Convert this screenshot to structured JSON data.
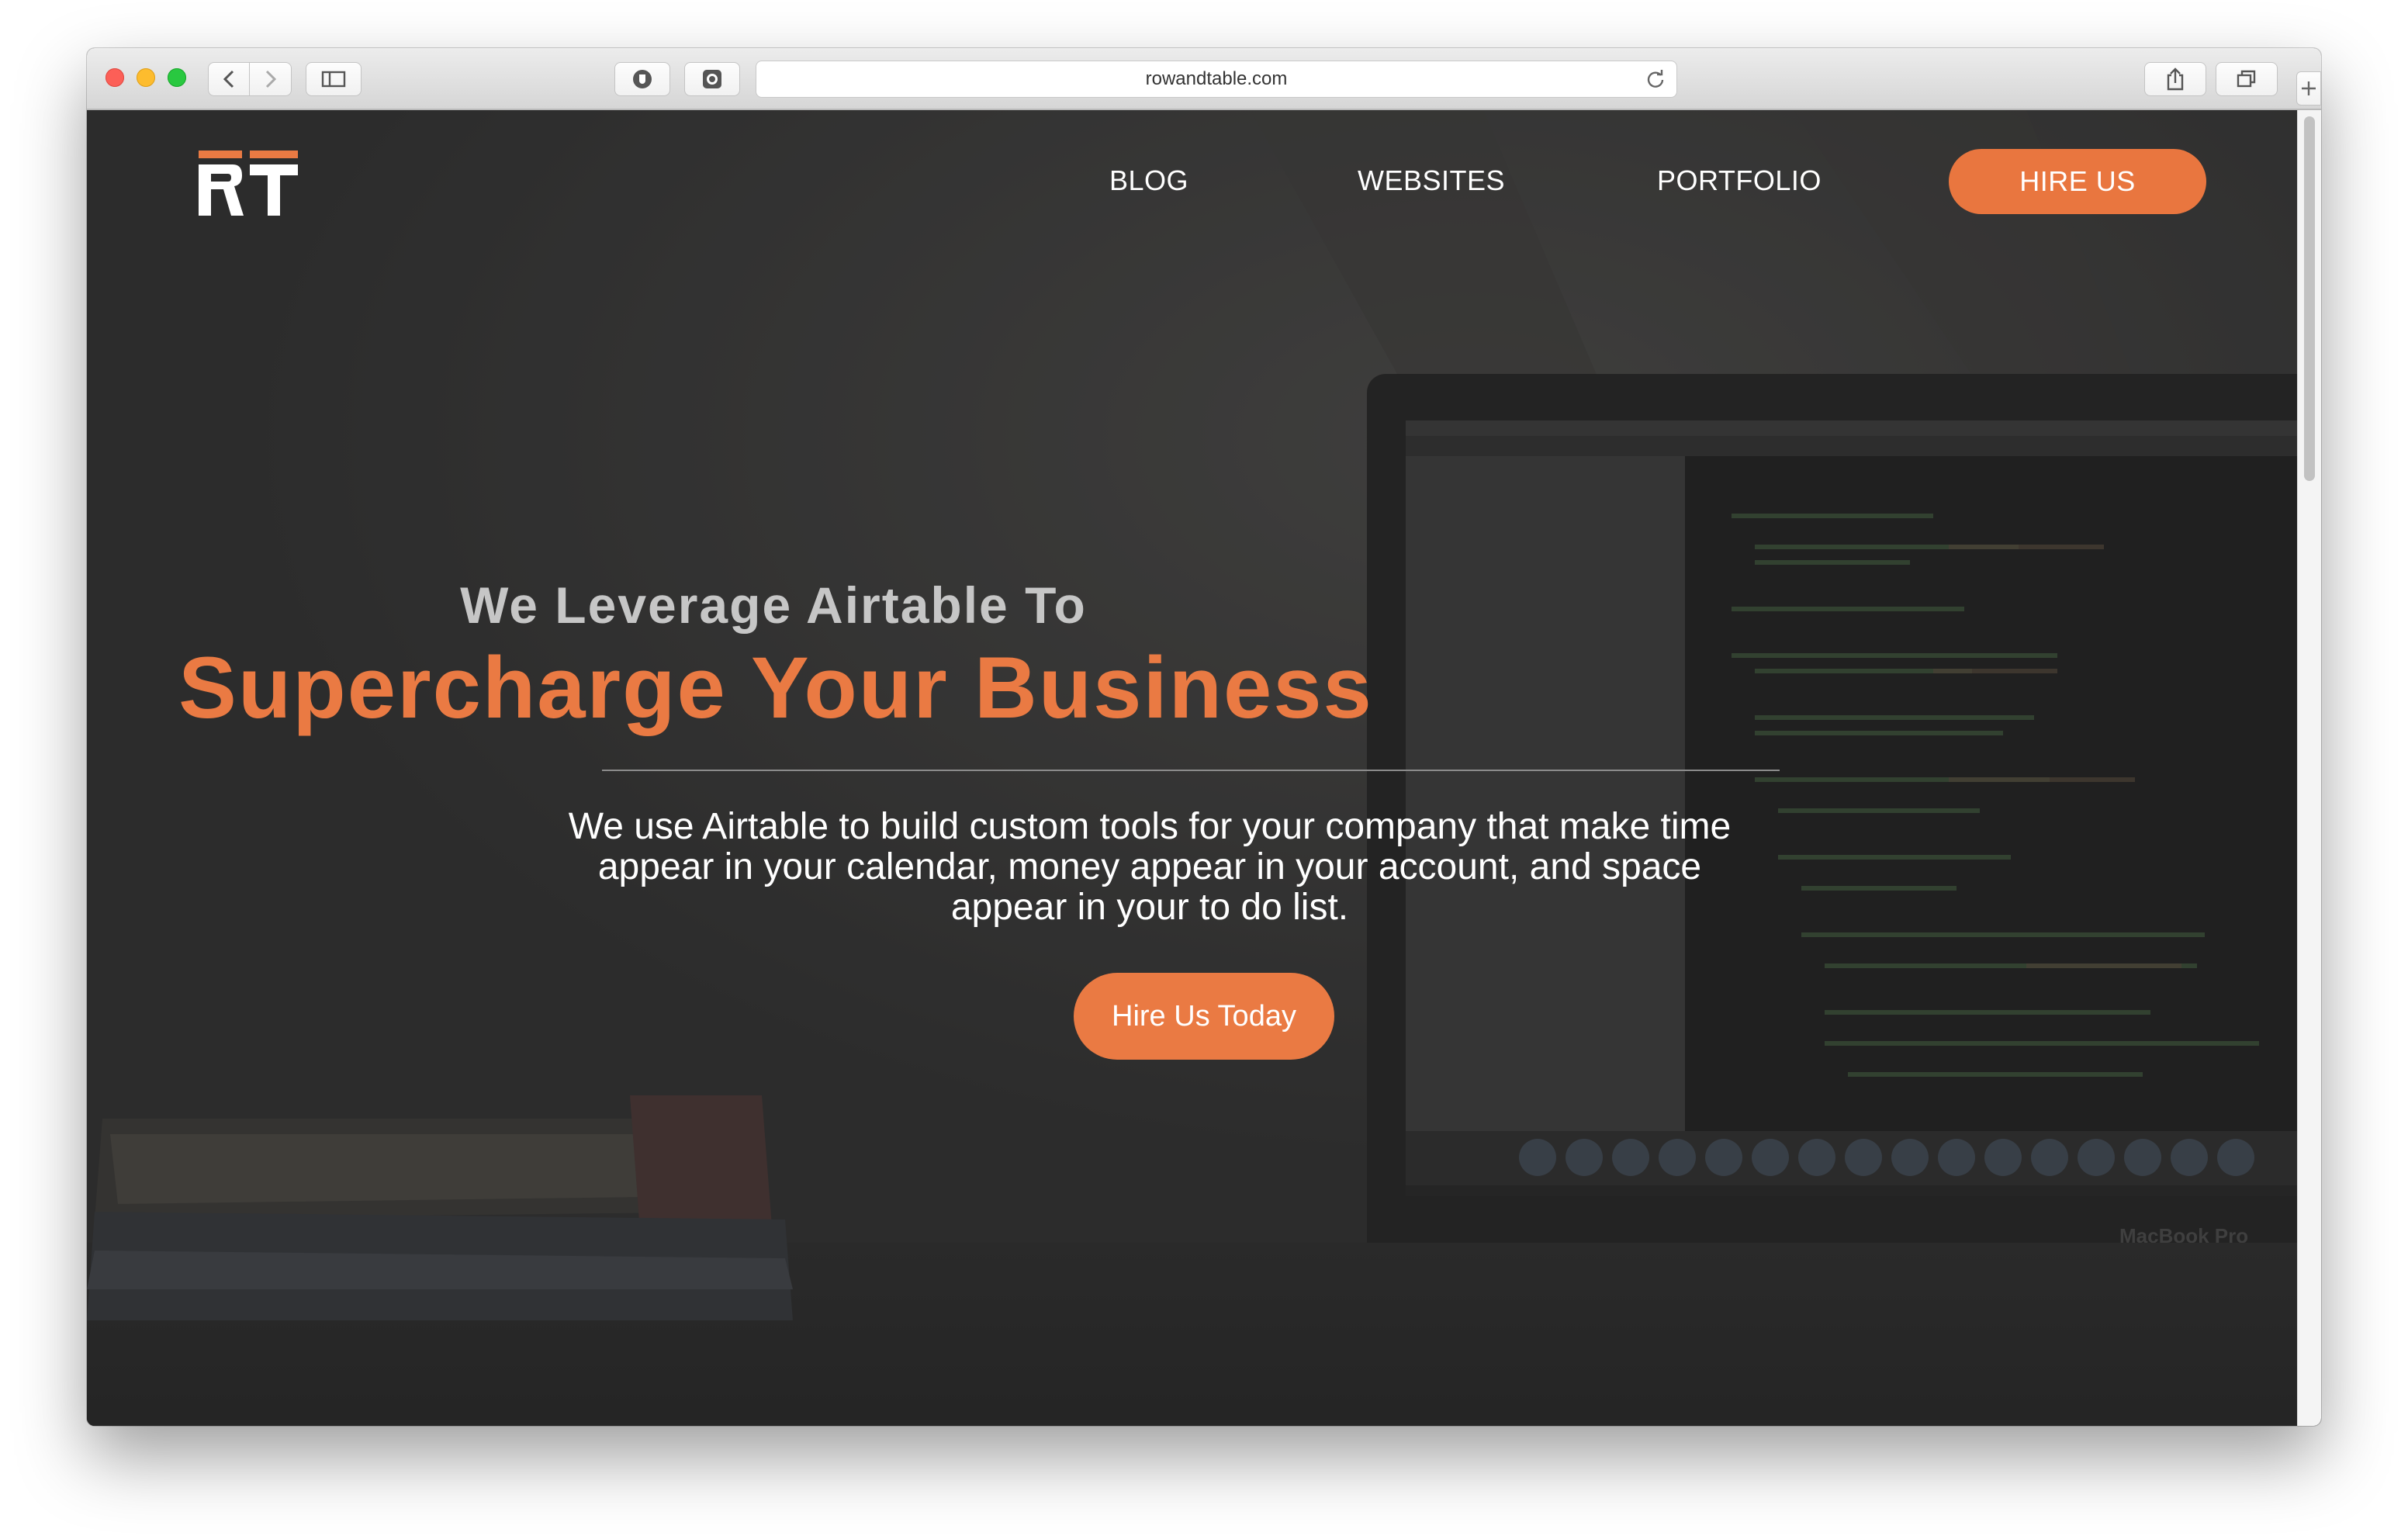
{
  "browser": {
    "url": "rowandtable.com"
  },
  "site": {
    "logo_text": "RT",
    "nav": {
      "blog": "BLOG",
      "websites": "WEBSITES",
      "portfolio": "PORTFOLIO",
      "hire": "HIRE US"
    },
    "hero": {
      "kicker": "We Leverage Airtable To",
      "headline": "Supercharge Your Business",
      "lead": "We use Airtable to build custom tools for your company that make time appear in your calendar, money appear in your account, and space appear in your to do list.",
      "cta": "Hire Us Today"
    },
    "background_laptop_label": "MacBook Pro"
  },
  "colors": {
    "accent": "#ea7a43",
    "overlay": "#313131",
    "kicker": "#c6c6c6"
  }
}
